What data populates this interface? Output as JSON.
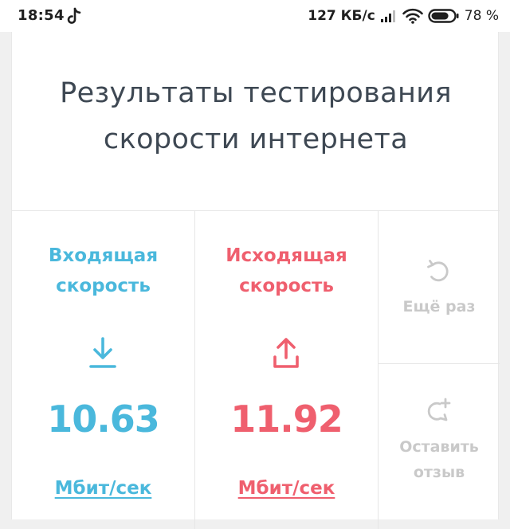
{
  "status_bar": {
    "time": "18:54",
    "network_speed": "127 КБ/с",
    "battery_percent": "78 %",
    "battery_level": 0.78,
    "icons": [
      "tiktok-note-icon",
      "signal-icon",
      "wifi-icon",
      "battery-icon"
    ]
  },
  "card": {
    "title_line1": "Результаты тестирования",
    "title_line2": "скорости интернета"
  },
  "download": {
    "label_line1": "Входящая",
    "label_line2": "скорость",
    "value": "10.63",
    "unit": "Мбит/сек",
    "color": "#4ab8dc",
    "icon": "download-icon"
  },
  "upload": {
    "label_line1": "Исходящая",
    "label_line2": "скорость",
    "value": "11.92",
    "unit": "Мбит/сек",
    "color": "#ef5f6e",
    "icon": "upload-icon"
  },
  "actions": {
    "retry_label": "Ещё раз",
    "retry_icon": "refresh-icon",
    "feedback_line1": "Оставить",
    "feedback_line2": "отзыв",
    "feedback_icon": "add-comment-icon"
  },
  "colors": {
    "title": "#3e4853",
    "muted": "#c9c9c9"
  }
}
